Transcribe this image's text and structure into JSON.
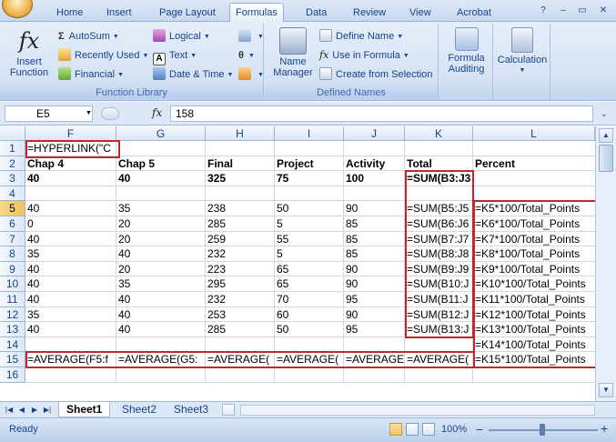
{
  "tabs": [
    "Home",
    "Insert",
    "Page Layout",
    "Formulas",
    "Data",
    "Review",
    "View",
    "Acrobat"
  ],
  "active_tab": "Formulas",
  "ribbon": {
    "insert_function": "Insert Function",
    "autosum": "AutoSum",
    "recently_used": "Recently Used",
    "financial": "Financial",
    "logical": "Logical",
    "text": "Text",
    "date_time": "Date & Time",
    "function_library_label": "Function Library",
    "name_manager": "Name Manager",
    "define_name": "Define Name",
    "use_in_formula": "Use in Formula",
    "create_from_selection": "Create from Selection",
    "defined_names_label": "Defined Names",
    "formula_auditing": "Formula Auditing",
    "calculation": "Calculation"
  },
  "formula_bar": {
    "name_box": "E5",
    "fx": "fx",
    "value": "158"
  },
  "columns": [
    "F",
    "G",
    "H",
    "I",
    "J",
    "K",
    "L"
  ],
  "rows": [
    "1",
    "2",
    "3",
    "4",
    "5",
    "6",
    "7",
    "8",
    "9",
    "10",
    "11",
    "12",
    "13",
    "14",
    "15",
    "16"
  ],
  "cells": {
    "r1": {
      "F": "=HYPERLINK(\"C"
    },
    "r2": {
      "F": "Chap 4",
      "G": "Chap 5",
      "H": "Final",
      "I": "Project",
      "J": "Activity",
      "K": "Total",
      "L": "Percent"
    },
    "r3": {
      "F": "40",
      "G": "40",
      "H": "325",
      "I": "75",
      "J": "100",
      "K": "=SUM(B3:J3"
    },
    "r5": {
      "F": "40",
      "G": "35",
      "H": "238",
      "I": "50",
      "J": "90",
      "K": "=SUM(B5:J5",
      "L": "=K5*100/Total_Points"
    },
    "r6": {
      "F": "0",
      "G": "20",
      "H": "285",
      "I": "5",
      "J": "85",
      "K": "=SUM(B6:J6",
      "L": "=K6*100/Total_Points"
    },
    "r7": {
      "F": "40",
      "G": "20",
      "H": "259",
      "I": "55",
      "J": "85",
      "K": "=SUM(B7:J7",
      "L": "=K7*100/Total_Points"
    },
    "r8": {
      "F": "35",
      "G": "40",
      "H": "232",
      "I": "5",
      "J": "85",
      "K": "=SUM(B8:J8",
      "L": "=K8*100/Total_Points"
    },
    "r9": {
      "F": "40",
      "G": "20",
      "H": "223",
      "I": "65",
      "J": "90",
      "K": "=SUM(B9:J9",
      "L": "=K9*100/Total_Points"
    },
    "r10": {
      "F": "40",
      "G": "35",
      "H": "295",
      "I": "65",
      "J": "90",
      "K": "=SUM(B10:J",
      "L": "=K10*100/Total_Points"
    },
    "r11": {
      "F": "40",
      "G": "40",
      "H": "232",
      "I": "70",
      "J": "95",
      "K": "=SUM(B11:J",
      "L": "=K11*100/Total_Points"
    },
    "r12": {
      "F": "35",
      "G": "40",
      "H": "253",
      "I": "60",
      "J": "90",
      "K": "=SUM(B12:J",
      "L": "=K12*100/Total_Points"
    },
    "r13": {
      "F": "40",
      "G": "40",
      "H": "285",
      "I": "50",
      "J": "95",
      "K": "=SUM(B13:J",
      "L": "=K13*100/Total_Points"
    },
    "r14": {
      "L": "=K14*100/Total_Points"
    },
    "r15": {
      "F": "=AVERAGE(F5:f",
      "G": "=AVERAGE(G5:",
      "H": "=AVERAGE(",
      "I": "=AVERAGE(",
      "J": "=AVERAGE",
      "K": "=AVERAGE(",
      "L": "=K15*100/Total_Points"
    }
  },
  "sheets": [
    "Sheet1",
    "Sheet2",
    "Sheet3"
  ],
  "active_sheet": "Sheet1",
  "status": {
    "ready": "Ready",
    "zoom": "100%"
  },
  "colors": {
    "highlight_border": "#c0282d",
    "ribbon_text": "#15428b"
  }
}
